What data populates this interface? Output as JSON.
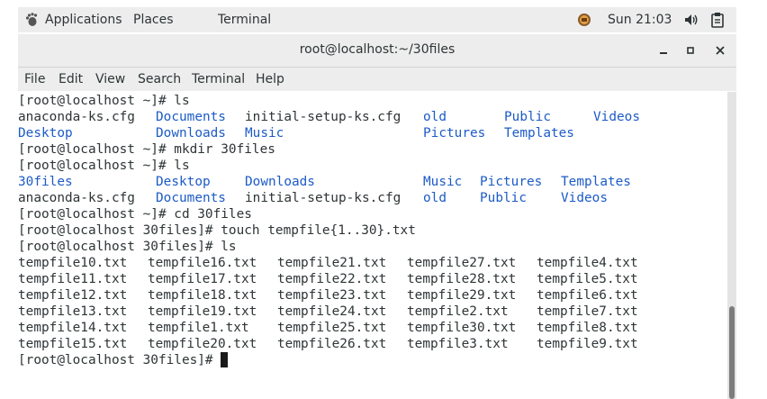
{
  "topbar": {
    "applications": "Applications",
    "places": "Places",
    "terminal": "Terminal",
    "clock": "Sun 21:03"
  },
  "window": {
    "title": "root@localhost:~/30files"
  },
  "menubar": {
    "items": [
      "File",
      "Edit",
      "View",
      "Search",
      "Terminal",
      "Help"
    ]
  },
  "terminal": {
    "lines": [
      {
        "tokens": [
          {
            "text": "[root@localhost ~]# ls",
            "col": 0,
            "dir": false
          }
        ]
      },
      {
        "tokens": [
          {
            "text": "anaconda-ks.cfg",
            "col": 0,
            "dir": false
          },
          {
            "text": "Documents",
            "col": 17,
            "dir": true
          },
          {
            "text": "initial-setup-ks.cfg",
            "col": 28,
            "dir": false
          },
          {
            "text": "old",
            "col": 50,
            "dir": true
          },
          {
            "text": "Public",
            "col": 60,
            "dir": true
          },
          {
            "text": "Videos",
            "col": 71,
            "dir": true
          }
        ]
      },
      {
        "tokens": [
          {
            "text": "Desktop",
            "col": 0,
            "dir": true
          },
          {
            "text": "Downloads",
            "col": 17,
            "dir": true
          },
          {
            "text": "Music",
            "col": 28,
            "dir": true
          },
          {
            "text": "Pictures",
            "col": 50,
            "dir": true
          },
          {
            "text": "Templates",
            "col": 60,
            "dir": true
          }
        ]
      },
      {
        "tokens": [
          {
            "text": "[root@localhost ~]# mkdir 30files",
            "col": 0,
            "dir": false
          }
        ]
      },
      {
        "tokens": [
          {
            "text": "[root@localhost ~]# ls",
            "col": 0,
            "dir": false
          }
        ]
      },
      {
        "tokens": [
          {
            "text": "30files",
            "col": 0,
            "dir": true
          },
          {
            "text": "Desktop",
            "col": 17,
            "dir": true
          },
          {
            "text": "Downloads",
            "col": 28,
            "dir": true
          },
          {
            "text": "Music",
            "col": 50,
            "dir": true
          },
          {
            "text": "Pictures",
            "col": 57,
            "dir": true
          },
          {
            "text": "Templates",
            "col": 67,
            "dir": true
          }
        ]
      },
      {
        "tokens": [
          {
            "text": "anaconda-ks.cfg",
            "col": 0,
            "dir": false
          },
          {
            "text": "Documents",
            "col": 17,
            "dir": true
          },
          {
            "text": "initial-setup-ks.cfg",
            "col": 28,
            "dir": false
          },
          {
            "text": "old",
            "col": 50,
            "dir": true
          },
          {
            "text": "Public",
            "col": 57,
            "dir": true
          },
          {
            "text": "Videos",
            "col": 67,
            "dir": true
          }
        ]
      },
      {
        "tokens": [
          {
            "text": "[root@localhost ~]# cd 30files",
            "col": 0,
            "dir": false
          }
        ]
      },
      {
        "tokens": [
          {
            "text": "[root@localhost 30files]# touch tempfile{1..30}.txt",
            "col": 0,
            "dir": false
          }
        ]
      },
      {
        "tokens": [
          {
            "text": "[root@localhost 30files]# ls",
            "col": 0,
            "dir": false
          }
        ]
      },
      {
        "tokens": [
          {
            "text": "tempfile10.txt",
            "col": 0,
            "dir": false
          },
          {
            "text": "tempfile16.txt",
            "col": 16,
            "dir": false
          },
          {
            "text": "tempfile21.txt",
            "col": 32,
            "dir": false
          },
          {
            "text": "tempfile27.txt",
            "col": 48,
            "dir": false
          },
          {
            "text": "tempfile4.txt",
            "col": 64,
            "dir": false
          }
        ]
      },
      {
        "tokens": [
          {
            "text": "tempfile11.txt",
            "col": 0,
            "dir": false
          },
          {
            "text": "tempfile17.txt",
            "col": 16,
            "dir": false
          },
          {
            "text": "tempfile22.txt",
            "col": 32,
            "dir": false
          },
          {
            "text": "tempfile28.txt",
            "col": 48,
            "dir": false
          },
          {
            "text": "tempfile5.txt",
            "col": 64,
            "dir": false
          }
        ]
      },
      {
        "tokens": [
          {
            "text": "tempfile12.txt",
            "col": 0,
            "dir": false
          },
          {
            "text": "tempfile18.txt",
            "col": 16,
            "dir": false
          },
          {
            "text": "tempfile23.txt",
            "col": 32,
            "dir": false
          },
          {
            "text": "tempfile29.txt",
            "col": 48,
            "dir": false
          },
          {
            "text": "tempfile6.txt",
            "col": 64,
            "dir": false
          }
        ]
      },
      {
        "tokens": [
          {
            "text": "tempfile13.txt",
            "col": 0,
            "dir": false
          },
          {
            "text": "tempfile19.txt",
            "col": 16,
            "dir": false
          },
          {
            "text": "tempfile24.txt",
            "col": 32,
            "dir": false
          },
          {
            "text": "tempfile2.txt",
            "col": 48,
            "dir": false
          },
          {
            "text": "tempfile7.txt",
            "col": 64,
            "dir": false
          }
        ]
      },
      {
        "tokens": [
          {
            "text": "tempfile14.txt",
            "col": 0,
            "dir": false
          },
          {
            "text": "tempfile1.txt",
            "col": 16,
            "dir": false
          },
          {
            "text": "tempfile25.txt",
            "col": 32,
            "dir": false
          },
          {
            "text": "tempfile30.txt",
            "col": 48,
            "dir": false
          },
          {
            "text": "tempfile8.txt",
            "col": 64,
            "dir": false
          }
        ]
      },
      {
        "tokens": [
          {
            "text": "tempfile15.txt",
            "col": 0,
            "dir": false
          },
          {
            "text": "tempfile20.txt",
            "col": 16,
            "dir": false
          },
          {
            "text": "tempfile26.txt",
            "col": 32,
            "dir": false
          },
          {
            "text": "tempfile3.txt",
            "col": 48,
            "dir": false
          },
          {
            "text": "tempfile9.txt",
            "col": 64,
            "dir": false
          }
        ]
      },
      {
        "tokens": [
          {
            "text": "[root@localhost 30files]# ",
            "col": 0,
            "dir": false
          }
        ],
        "cursor": true
      }
    ]
  },
  "colors": {
    "directory": "#1c5bc7",
    "text": "#2e3436",
    "panel": "#ededed"
  }
}
